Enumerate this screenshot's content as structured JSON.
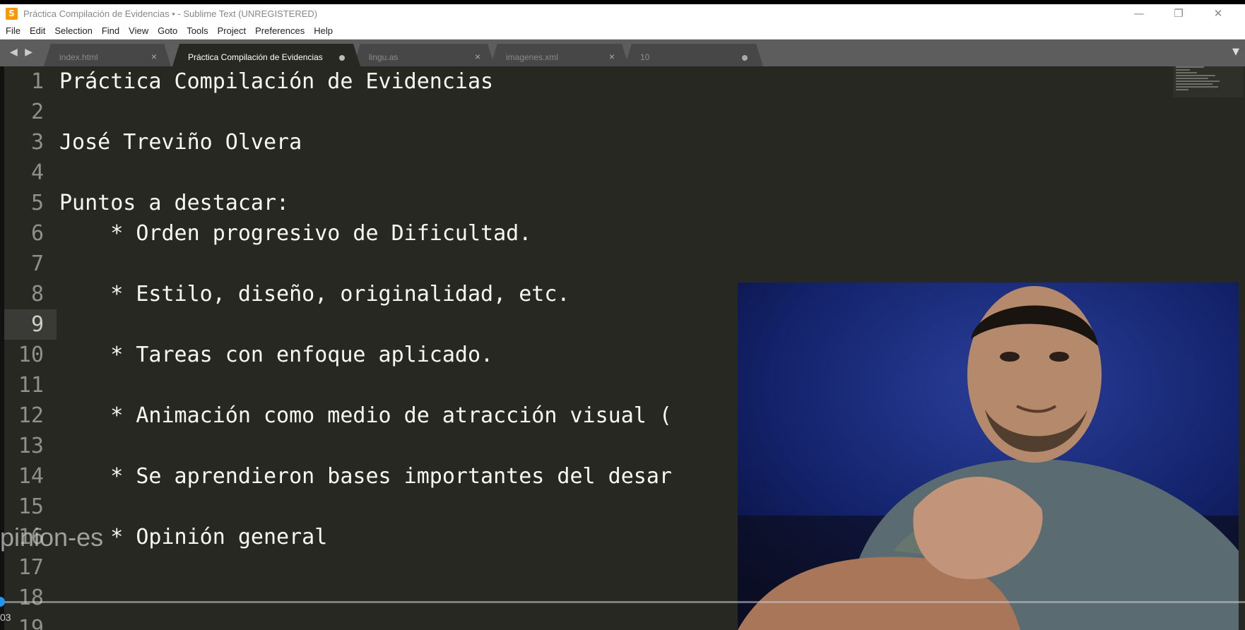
{
  "window": {
    "title": "Práctica Compilación de Evidencias • - Sublime Text (UNREGISTERED)",
    "app_icon": "S",
    "controls": {
      "minimize": "—",
      "maximize": "❐",
      "close": "✕"
    }
  },
  "menu": [
    "File",
    "Edit",
    "Selection",
    "Find",
    "View",
    "Goto",
    "Tools",
    "Project",
    "Preferences",
    "Help"
  ],
  "tabs": [
    {
      "label": "index.html",
      "active": false,
      "modified": false
    },
    {
      "label": "Práctica Compilación de Evidencias",
      "active": true,
      "modified": true
    },
    {
      "label": "lingu.as",
      "active": false,
      "modified": false
    },
    {
      "label": "imagenes.xml",
      "active": false,
      "modified": false
    },
    {
      "label": "10",
      "active": false,
      "modified": true
    }
  ],
  "nav_arrows": "◀ ▶",
  "tab_dropdown": "▼",
  "editor": {
    "current_line": 9,
    "lines": [
      {
        "n": "1",
        "text": "Práctica Compilación de Evidencias"
      },
      {
        "n": "2",
        "text": ""
      },
      {
        "n": "3",
        "text": "José Treviño Olvera"
      },
      {
        "n": "4",
        "text": ""
      },
      {
        "n": "5",
        "text": "Puntos a destacar:"
      },
      {
        "n": "6",
        "text": "    * Orden progresivo de Dificultad."
      },
      {
        "n": "7",
        "text": ""
      },
      {
        "n": "8",
        "text": "    * Estilo, diseño, originalidad, etc."
      },
      {
        "n": "9",
        "text": ""
      },
      {
        "n": "10",
        "text": "    * Tareas con enfoque aplicado."
      },
      {
        "n": "11",
        "text": ""
      },
      {
        "n": "12",
        "text": "    * Animación como medio de atracción visual ("
      },
      {
        "n": "13",
        "text": ""
      },
      {
        "n": "14",
        "text": "    * Se aprendieron bases importantes del desar"
      },
      {
        "n": "15",
        "text": ""
      },
      {
        "n": "16",
        "text": "    * Opinión general"
      },
      {
        "n": "17",
        "text": ""
      },
      {
        "n": "18",
        "text": ""
      },
      {
        "n": "19",
        "text": ""
      }
    ]
  },
  "overlay": {
    "caption": "pinion-es",
    "time": "03"
  },
  "colors": {
    "editor_bg": "#272822",
    "text": "#f8f8f2",
    "line_numbers": "#8f908a",
    "seek_handle": "#2196f3"
  },
  "icons": {
    "webcam": "webcam-person-feed"
  }
}
